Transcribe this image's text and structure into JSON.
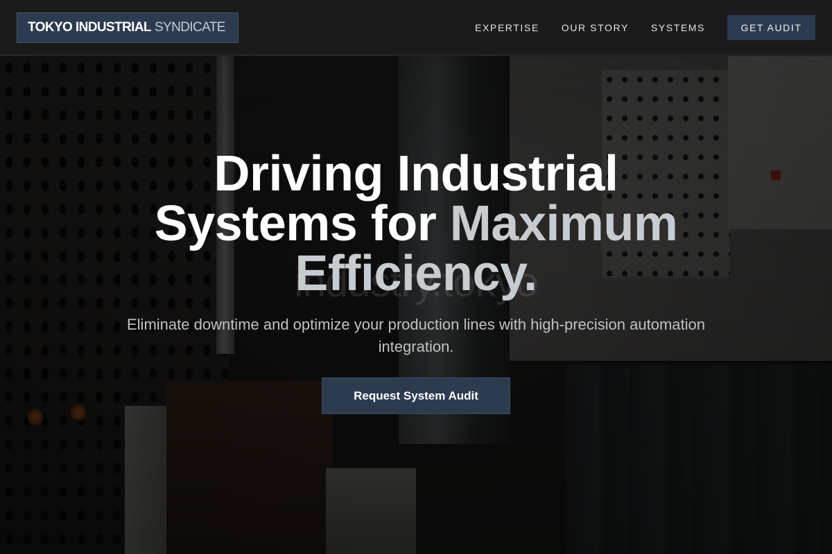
{
  "header": {
    "logo": {
      "strong": "TOKYO INDUSTRIAL",
      "light": "SYNDICATE"
    },
    "nav": [
      {
        "label": "EXPERTISE"
      },
      {
        "label": "OUR STORY"
      },
      {
        "label": "SYSTEMS"
      }
    ],
    "cta_label": "GET AUDIT"
  },
  "hero": {
    "title_line1": "Driving Industrial",
    "title_line2_plain": "Systems for ",
    "title_line2_accent": "Maximum",
    "title_line3_accent": "Efficiency.",
    "watermark": "industry.tokyo",
    "subtitle": "Eliminate downtime and optimize your production lines with high-precision automation integration.",
    "cta_label": "Request System Audit"
  },
  "colors": {
    "brand": "#2d3b50",
    "header_bg": "#1b1b1b",
    "accent_text": "#c7ccd1",
    "body_text": "#c2c2c2"
  }
}
